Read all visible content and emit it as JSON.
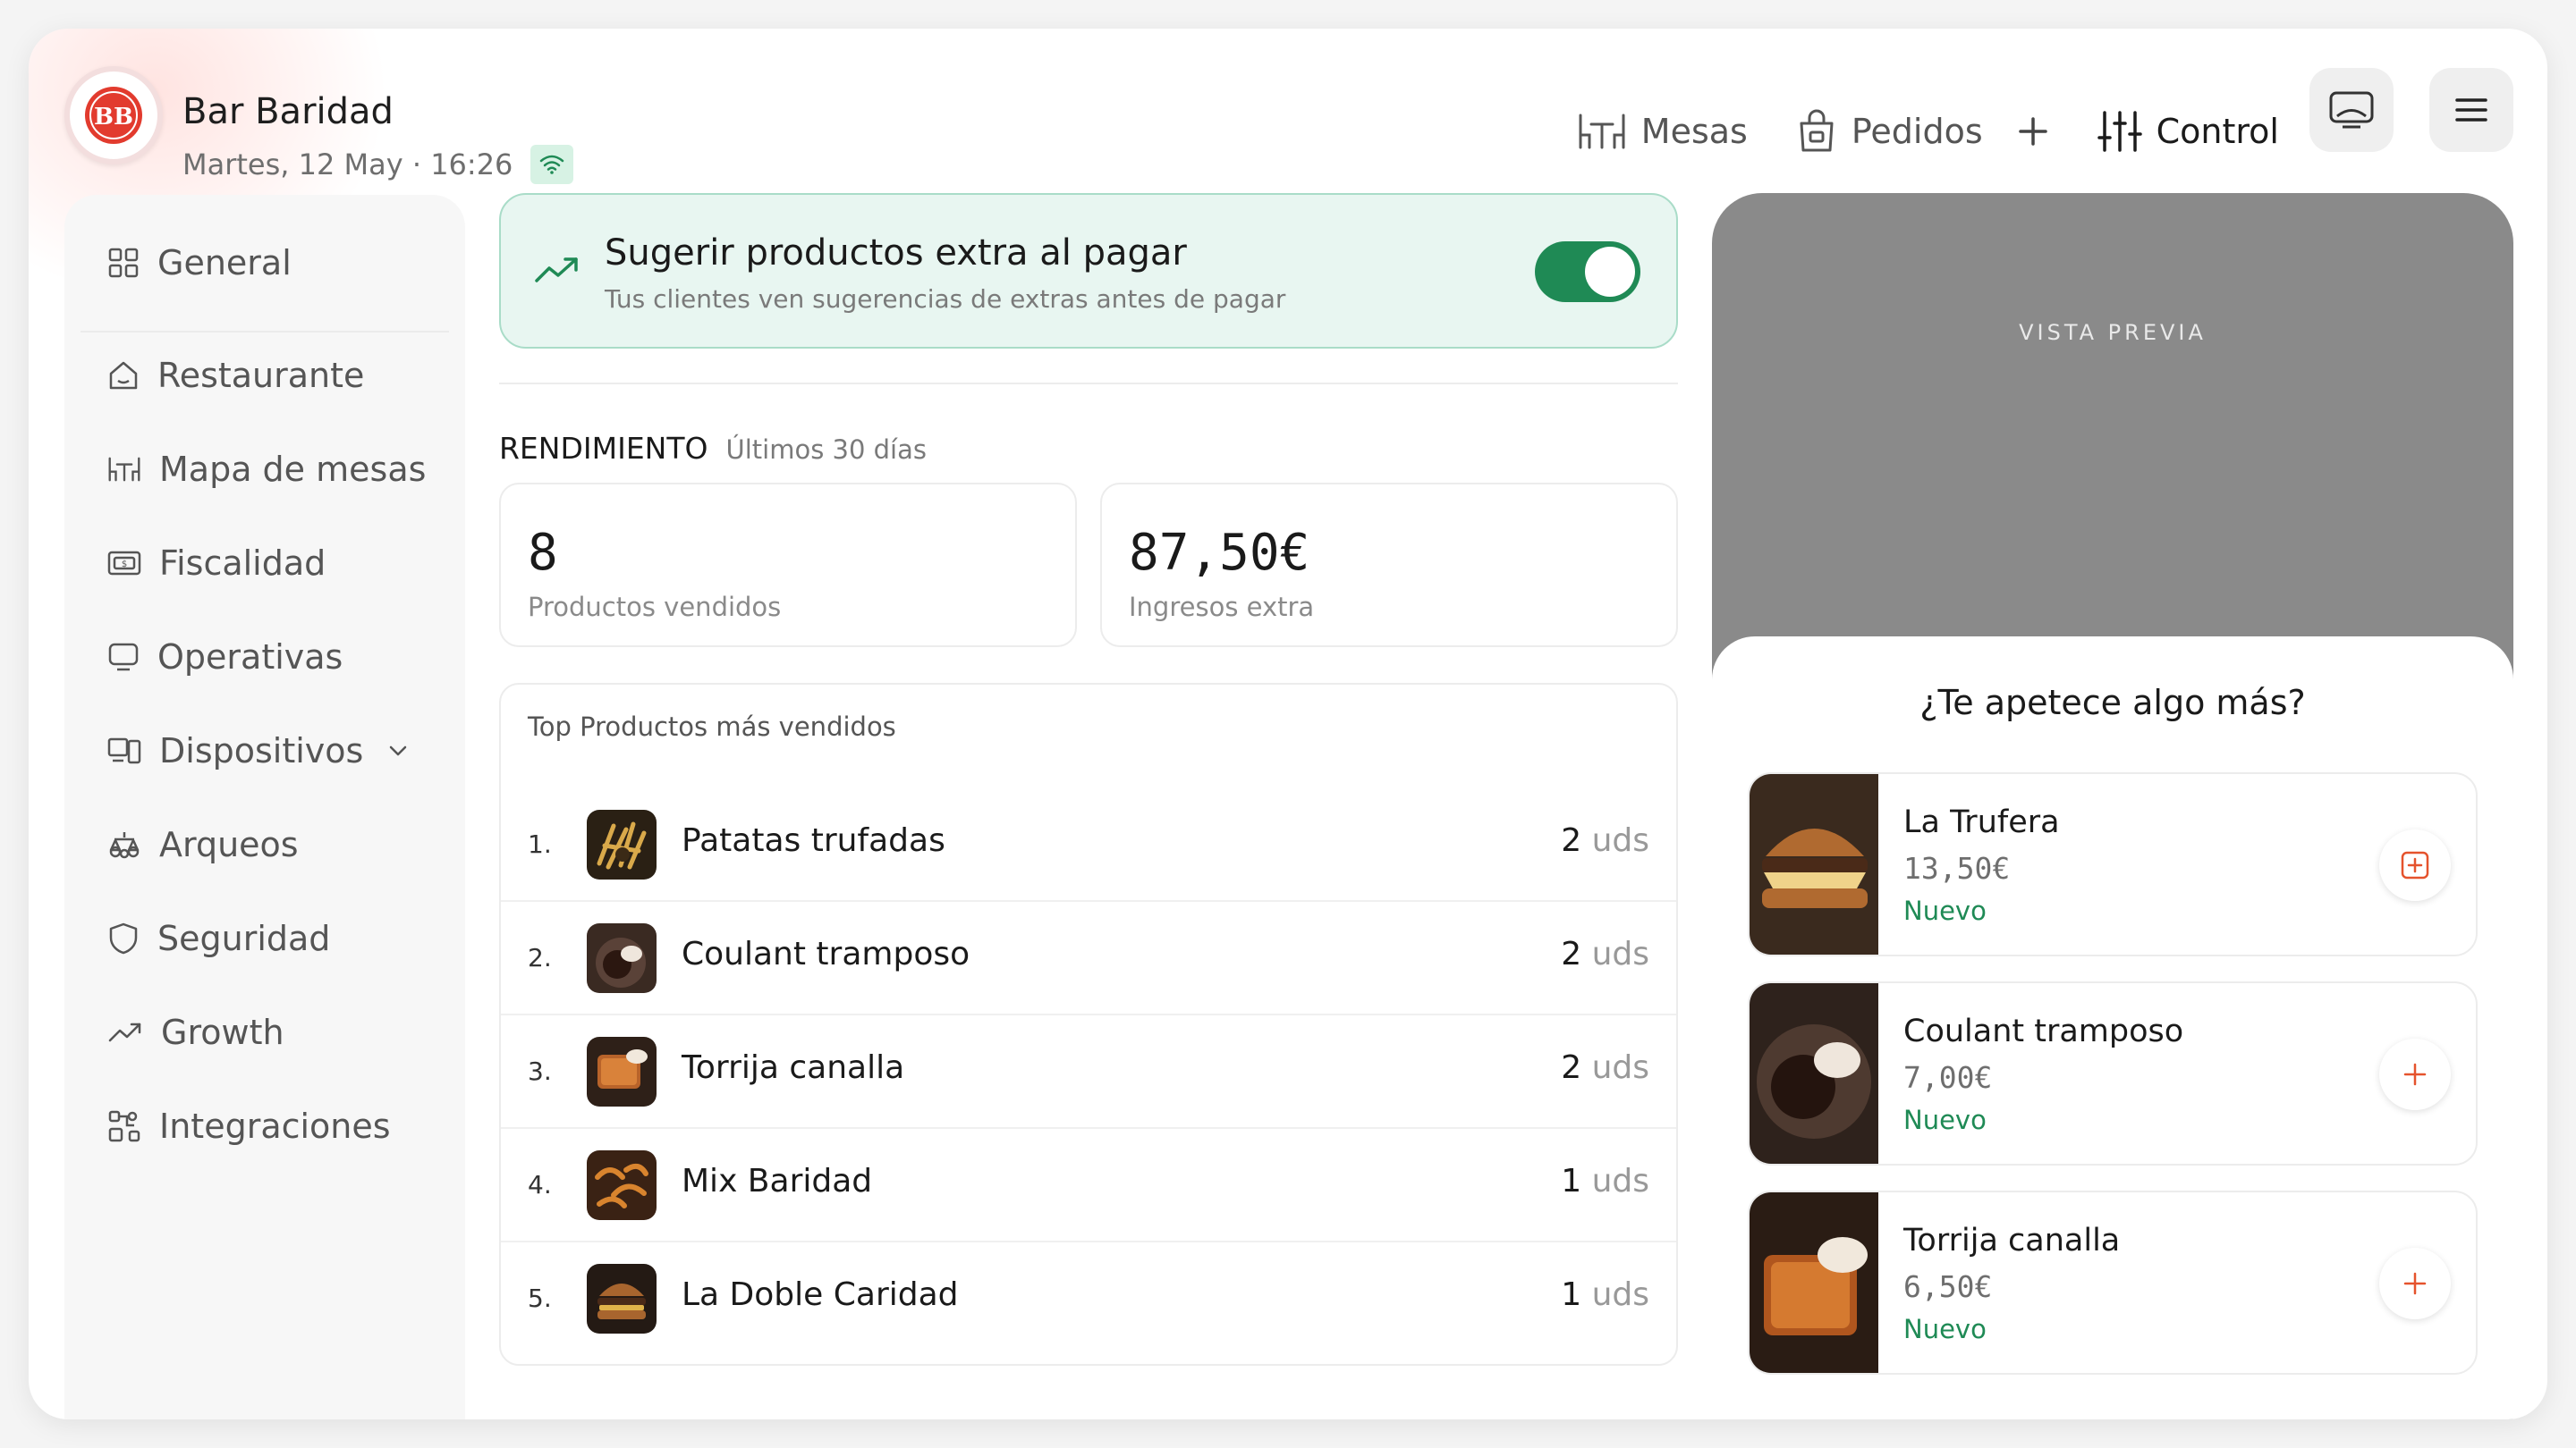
{
  "header": {
    "brand_name": "Bar Baridad",
    "logo_text": "BB",
    "date_time": "Martes, 12 May · 16:26",
    "nav": {
      "mesas": "Mesas",
      "pedidos": "Pedidos",
      "control": "Control"
    }
  },
  "sidebar": {
    "items": [
      {
        "label": "General",
        "icon": "grid-icon"
      },
      {
        "label": "Restaurante",
        "icon": "home-icon"
      },
      {
        "label": "Mapa de mesas",
        "icon": "tables-icon"
      },
      {
        "label": "Fiscalidad",
        "icon": "receipt-icon"
      },
      {
        "label": "Operativas",
        "icon": "monitor-icon"
      },
      {
        "label": "Dispositivos",
        "icon": "devices-icon"
      },
      {
        "label": "Arqueos",
        "icon": "scale-icon"
      },
      {
        "label": "Seguridad",
        "icon": "shield-icon"
      },
      {
        "label": "Growth",
        "icon": "trend-icon"
      },
      {
        "label": "Integraciones",
        "icon": "integrations-icon"
      }
    ]
  },
  "suggest": {
    "title": "Sugerir productos extra al pagar",
    "subtitle": "Tus clientes ven sugerencias de extras antes de pagar",
    "enabled": true,
    "accent": "#1f8a55"
  },
  "performance": {
    "label": "RENDIMIENTO",
    "period": "Últimos 30 días",
    "stats": [
      {
        "value": "8",
        "caption": "Productos vendidos"
      },
      {
        "value": "87,50€",
        "caption": "Ingresos extra"
      }
    ]
  },
  "top_products": {
    "heading": "Top Productos más vendidos",
    "unit": "uds",
    "rows": [
      {
        "rank": "1.",
        "name": "Patatas trufadas",
        "qty": "2"
      },
      {
        "rank": "2.",
        "name": "Coulant tramposo",
        "qty": "2"
      },
      {
        "rank": "3.",
        "name": "Torrija canalla",
        "qty": "2"
      },
      {
        "rank": "4.",
        "name": "Mix Baridad",
        "qty": "1"
      },
      {
        "rank": "5.",
        "name": "La Doble Caridad",
        "qty": "1"
      }
    ]
  },
  "preview": {
    "label": "VISTA PREVIA",
    "question": "¿Te apetece algo más?",
    "products": [
      {
        "name": "La Trufera",
        "price": "13,50€",
        "tag": "Nuevo"
      },
      {
        "name": "Coulant tramposo",
        "price": "7,00€",
        "tag": "Nuevo"
      },
      {
        "name": "Torrija canalla",
        "price": "6,50€",
        "tag": "Nuevo"
      }
    ]
  }
}
